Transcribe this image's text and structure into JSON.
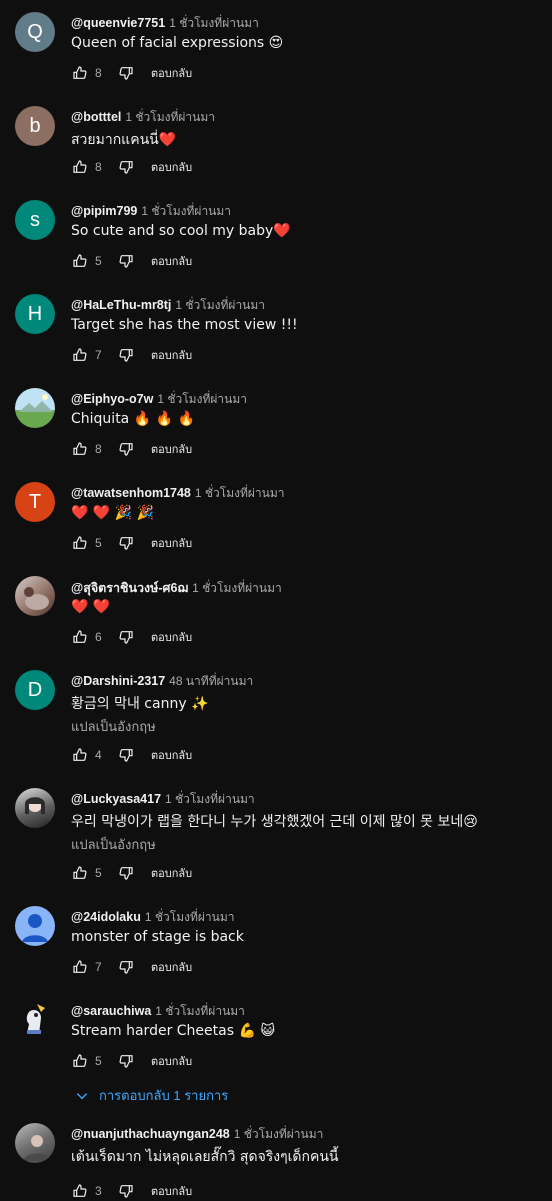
{
  "comments": [
    {
      "author": "@queenvie7751",
      "time": "1 ชั่วโมงที่ผ่านมา",
      "text": "Queen of facial expressions 😍",
      "likes": "8",
      "avatar_letter": "Q",
      "avatar_color": "#5f7c88"
    },
    {
      "author": "@botttel",
      "time": "1 ชั่วโมงที่ผ่านมา",
      "text": "สวยมากแคนนี่❤️",
      "likes": "8",
      "avatar_letter": "b",
      "avatar_color": "#8d6e63"
    },
    {
      "author": "@pipim799",
      "time": "1 ชั่วโมงที่ผ่านมา",
      "text": "So cute and so cool my baby❤️",
      "likes": "5",
      "avatar_letter": "s",
      "avatar_color": "#00897b"
    },
    {
      "author": "@HaLeThu-mr8tj",
      "time": "1 ชั่วโมงที่ผ่านมา",
      "text": "Target she has the most view !!!",
      "likes": "7",
      "avatar_letter": "H",
      "avatar_color": "#00897b"
    },
    {
      "author": "@Eiphyo-o7w",
      "time": "1 ชั่วโมงที่ผ่านมา",
      "text": "Chiquita 🔥 🔥 🔥",
      "likes": "8",
      "avatar_letter": "",
      "avatar_color": "#7fb3d5"
    },
    {
      "author": "@tawatsenhom1748",
      "time": "1 ชั่วโมงที่ผ่านมา",
      "text": "❤️ ❤️ 🎉 🎉",
      "likes": "5",
      "avatar_letter": "T",
      "avatar_color": "#d84315"
    },
    {
      "author": "@สุจิตราชินวงษ์-ศ6ฌ",
      "time": "1 ชั่วโมงที่ผ่านมา",
      "text": "❤️ ❤️",
      "likes": "6",
      "avatar_letter": "",
      "avatar_color": "#a1887f"
    },
    {
      "author": "@Darshini-2317",
      "time": "48 นาทีที่ผ่านมา",
      "text": "황금의 막내  canny ✨",
      "translate": "แปลเป็นอังกฤษ",
      "likes": "4",
      "avatar_letter": "D",
      "avatar_color": "#00897b"
    },
    {
      "author": "@Luckyasa417",
      "time": "1 ชั่วโมงที่ผ่านมา",
      "text": "우리 막냉이가 랩을 한다니 누가 생각했겠어 근데 이제 많이 못 보네😢",
      "translate": "แปลเป็นอังกฤษ",
      "likes": "5",
      "avatar_letter": "",
      "avatar_color": "#9e9e9e"
    },
    {
      "author": "@24idolaku",
      "time": "1 ชั่วโมงที่ผ่านมา",
      "text": "monster of stage is back",
      "likes": "7",
      "avatar_letter": "",
      "avatar_color": "#8ab4f8"
    },
    {
      "author": "@sarauchiwa",
      "time": "1 ชั่วโมงที่ผ่านมา",
      "text": "Stream harder Cheetas 💪 😺",
      "likes": "5",
      "avatar_letter": "",
      "avatar_color": "#0f0f0f"
    },
    {
      "author": "@nuanjuthachuayngan248",
      "time": "1 ชั่วโมงที่ผ่านมา",
      "text": "เต้นเร็ดมาก ไม่หลุดเลยสั๊กวิ สุดจริงๆเด็กคนนี้",
      "likes": "3",
      "avatar_letter": "",
      "avatar_color": "#8d8d8d"
    }
  ],
  "reply_label": "ตอบกลับ",
  "replies_toggle": {
    "label": "การตอบกลับ 1 รายการ",
    "color": "#3ea6ff"
  }
}
